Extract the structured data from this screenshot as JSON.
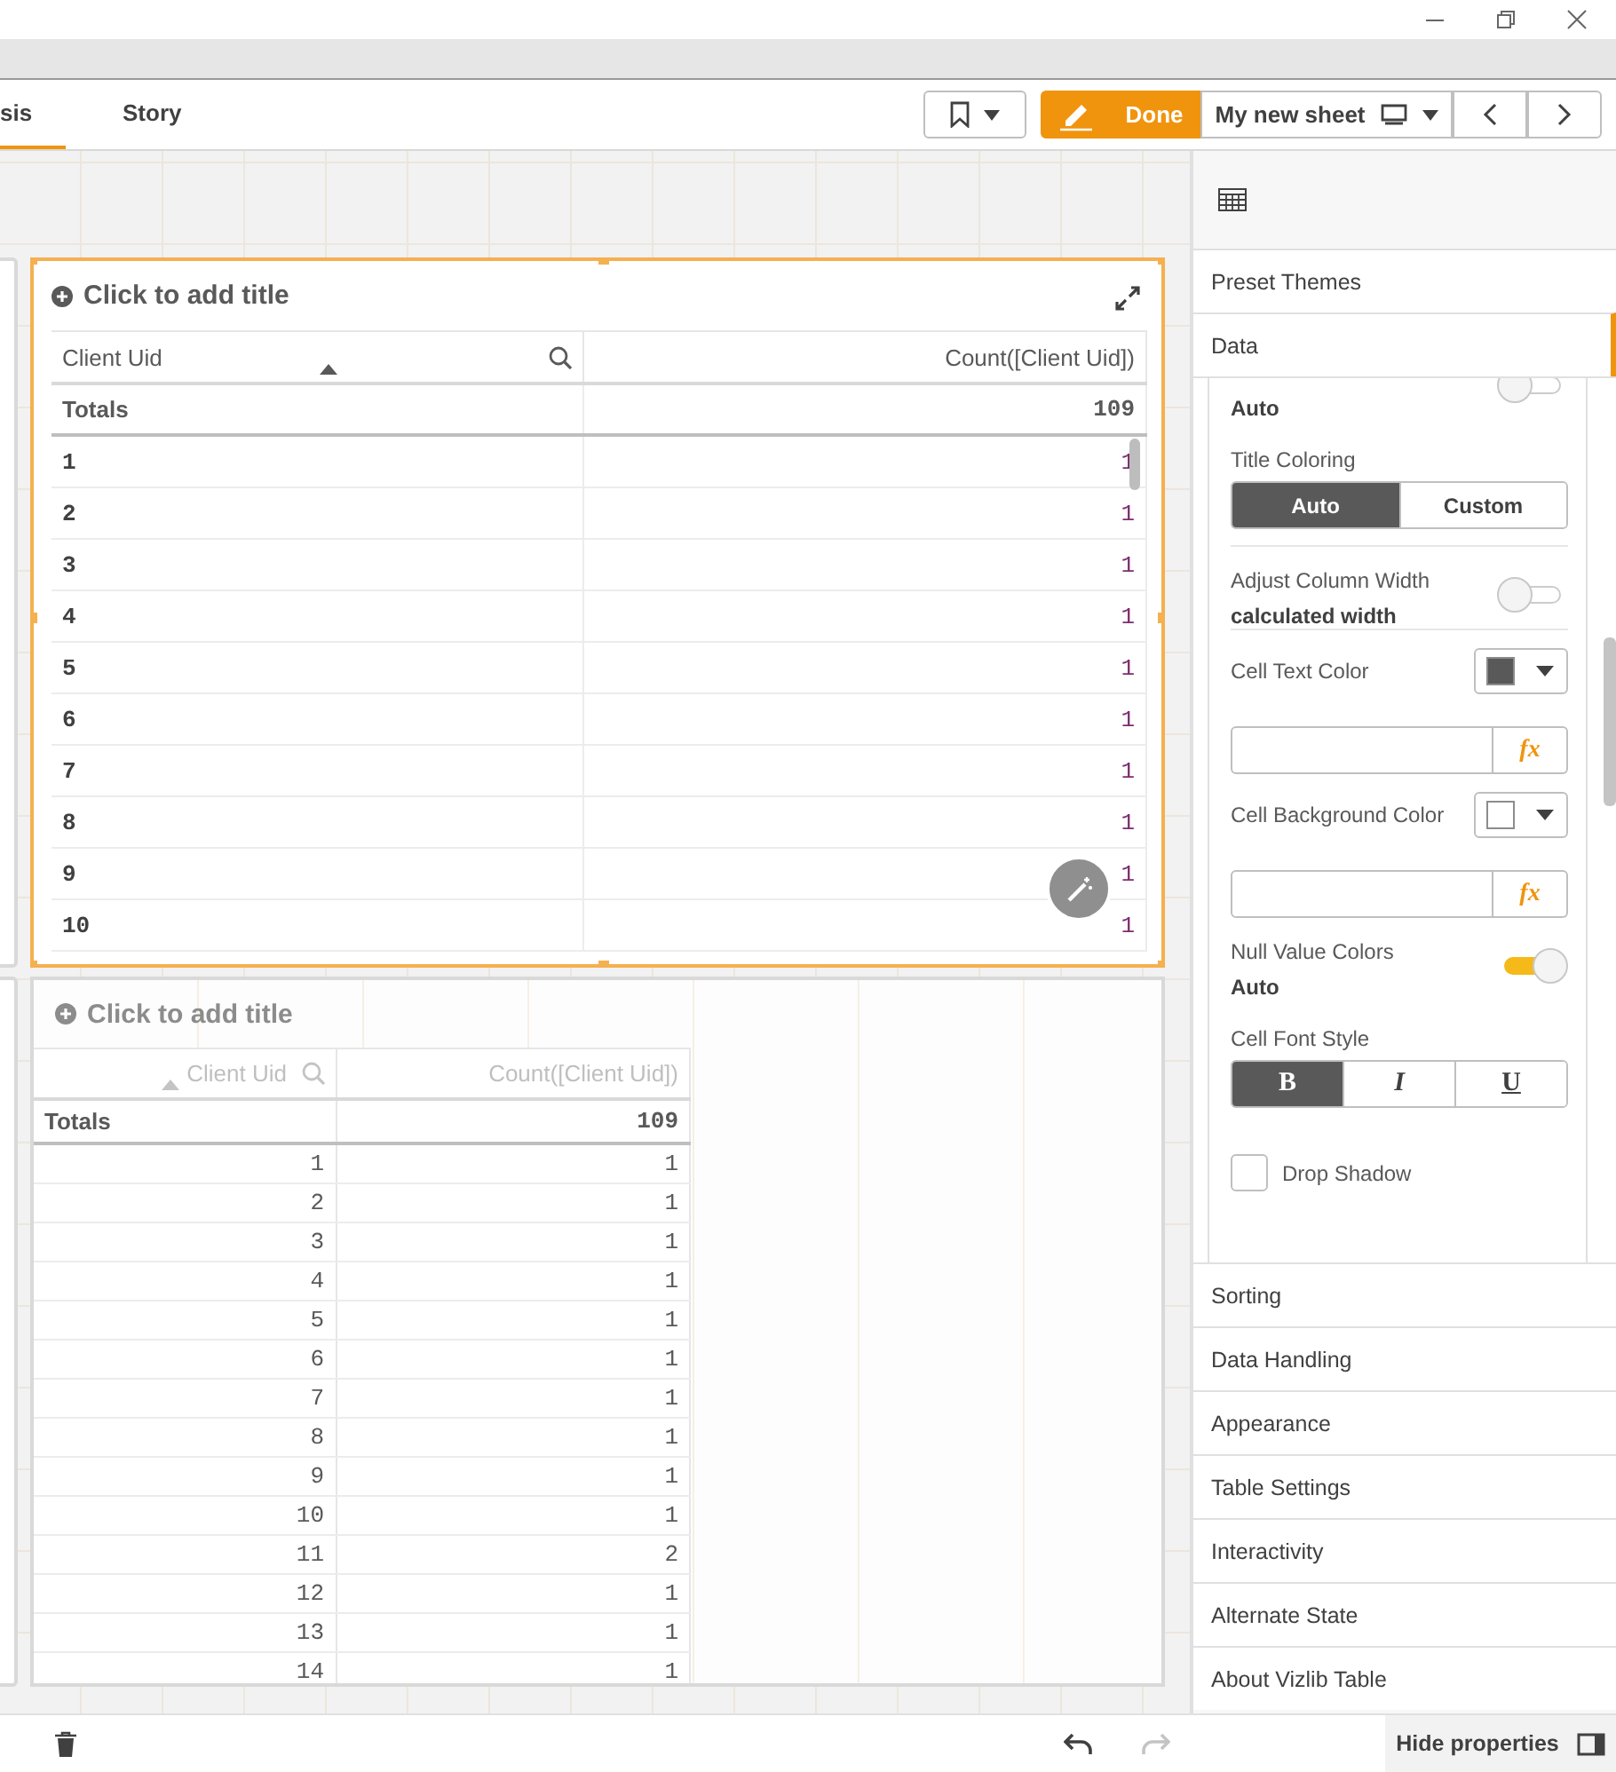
{
  "tabs": [
    {
      "label": "sis",
      "selected": true
    },
    {
      "label": "Story",
      "selected": false
    }
  ],
  "toolbar": {
    "done": "Done",
    "sheet": "My new sheet"
  },
  "tables": [
    {
      "selected": true,
      "title": "Click to add title",
      "columns": [
        "Client Uid",
        "Count([Client Uid])"
      ],
      "totals": [
        "Totals",
        "109"
      ],
      "rows": [
        [
          "1",
          "1"
        ],
        [
          "2",
          "1"
        ],
        [
          "3",
          "1"
        ],
        [
          "4",
          "1"
        ],
        [
          "5",
          "1"
        ],
        [
          "6",
          "1"
        ],
        [
          "7",
          "1"
        ],
        [
          "8",
          "1"
        ],
        [
          "9",
          "1"
        ],
        [
          "10",
          "1"
        ]
      ]
    },
    {
      "selected": false,
      "title": "Click to add title",
      "columns": [
        "Client Uid",
        "Count([Client Uid])"
      ],
      "totals": [
        "Totals",
        "109"
      ],
      "rows": [
        [
          "1",
          "1"
        ],
        [
          "2",
          "1"
        ],
        [
          "3",
          "1"
        ],
        [
          "4",
          "1"
        ],
        [
          "5",
          "1"
        ],
        [
          "6",
          "1"
        ],
        [
          "7",
          "1"
        ],
        [
          "8",
          "1"
        ],
        [
          "9",
          "1"
        ],
        [
          "10",
          "1"
        ],
        [
          "11",
          "2"
        ],
        [
          "12",
          "1"
        ],
        [
          "13",
          "1"
        ],
        [
          "14",
          "1"
        ]
      ]
    }
  ],
  "properties": {
    "sections_top": [
      {
        "label": "Preset Themes",
        "selected": false
      },
      {
        "label": "Data",
        "selected": true
      }
    ],
    "groups": [
      [
        {
          "kind": "toggle",
          "value": "Auto",
          "on": false
        },
        {
          "kind": "segmented",
          "label": "Title Coloring",
          "options": [
            {
              "label": "Auto",
              "selected": true
            },
            {
              "label": "Custom",
              "selected": false
            }
          ]
        }
      ],
      [
        {
          "kind": "toggle",
          "label": "Adjust Column Width",
          "value": "calculated width",
          "on": false
        }
      ],
      [
        {
          "kind": "color",
          "label": "Cell Text Color",
          "color": "#595959"
        },
        {
          "kind": "expression",
          "button": "fx"
        },
        {
          "kind": "color",
          "label": "Cell Background Color",
          "color": "#ffffff"
        },
        {
          "kind": "expression",
          "button": "fx"
        },
        {
          "kind": "toggle",
          "label": "Null Value Colors",
          "value": "Auto",
          "on": true
        },
        {
          "kind": "fontstyle",
          "label": "Cell Font Style",
          "options": [
            {
              "label": "B",
              "selected": true
            },
            {
              "label": "I",
              "selected": false
            },
            {
              "label": "U",
              "selected": false
            }
          ]
        },
        {
          "kind": "checkbox",
          "label": "Drop Shadow",
          "checked": false
        }
      ]
    ],
    "sections_bottom": [
      "Sorting",
      "Data Handling",
      "Appearance",
      "Table Settings",
      "Interactivity",
      "Alternate State",
      "About Vizlib Table"
    ]
  },
  "hide_properties": "Hide properties"
}
